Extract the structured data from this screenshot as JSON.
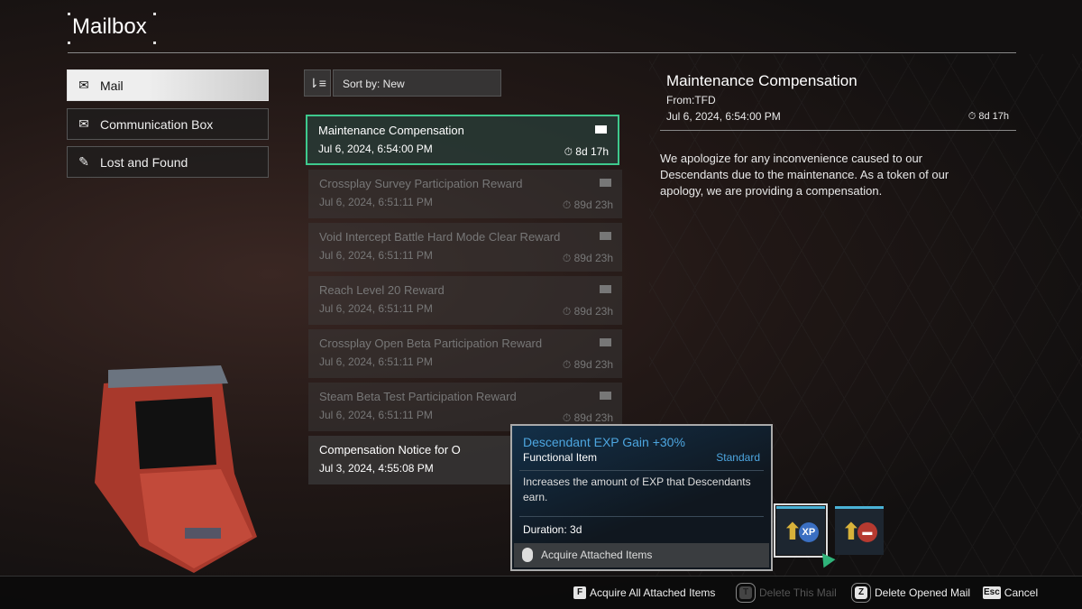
{
  "header": {
    "title": "Mailbox"
  },
  "nav": [
    {
      "label": "Mail",
      "icon": "envelope-icon",
      "active": true
    },
    {
      "label": "Communication Box",
      "icon": "envelope-icon"
    },
    {
      "label": "Lost and Found",
      "icon": "pin-icon"
    }
  ],
  "sort": {
    "label": "Sort by: New",
    "icon": "sort-icon"
  },
  "mails": [
    {
      "title": "Maintenance Compensation",
      "date": "Jul 6, 2024, 6:54:00 PM",
      "remaining": "8d 17h"
    },
    {
      "title": "Crossplay Survey Participation Reward",
      "date": "Jul 6, 2024, 6:51:11 PM",
      "remaining": "89d 23h"
    },
    {
      "title": "Void Intercept Battle Hard Mode Clear Reward",
      "date": "Jul 6, 2024, 6:51:11 PM",
      "remaining": "89d 23h"
    },
    {
      "title": "Reach Level 20 Reward",
      "date": "Jul 6, 2024, 6:51:11 PM",
      "remaining": "89d 23h"
    },
    {
      "title": "Crossplay Open Beta Participation Reward",
      "date": "Jul 6, 2024, 6:51:11 PM",
      "remaining": "89d 23h"
    },
    {
      "title": "Steam Beta Test Participation Reward",
      "date": "Jul 6, 2024, 6:51:11 PM",
      "remaining": "89d 23h"
    },
    {
      "title": "Compensation Notice for O",
      "date": "Jul 3, 2024, 4:55:08 PM",
      "remaining": ""
    }
  ],
  "detail": {
    "title": "Maintenance Compensation",
    "from": "From:TFD",
    "date": "Jul 6, 2024, 6:54:00 PM",
    "remaining": "8d 17h",
    "body": "We apologize for any inconvenience caused to our Descendants due to the maintenance. As a token of our apology, we are providing a compensation."
  },
  "tooltip": {
    "name": "Descendant EXP Gain +30%",
    "type": "Functional Item",
    "grade": "Standard",
    "description": "Increases the amount of EXP that Descendants earn.",
    "duration": "Duration:  3d",
    "action": "Acquire Attached Items"
  },
  "attachments": [
    {
      "icon": "exp-boost-icon",
      "badge": "XP",
      "color": "#3a6fc2"
    },
    {
      "icon": "weapon-boost-icon",
      "badge": "",
      "color": "#b63a30"
    }
  ],
  "footer": [
    {
      "key": "F",
      "label": "Acquire All Attached Items",
      "enabled": true
    },
    {
      "key": "T",
      "label": "Delete This Mail",
      "enabled": false
    },
    {
      "key": "Z",
      "label": "Delete Opened Mail",
      "enabled": true
    },
    {
      "key": "Esc",
      "label": "Cancel",
      "enabled": true
    }
  ],
  "colors": {
    "accent": "#3ec98d",
    "item_blue": "#4da6e0"
  }
}
